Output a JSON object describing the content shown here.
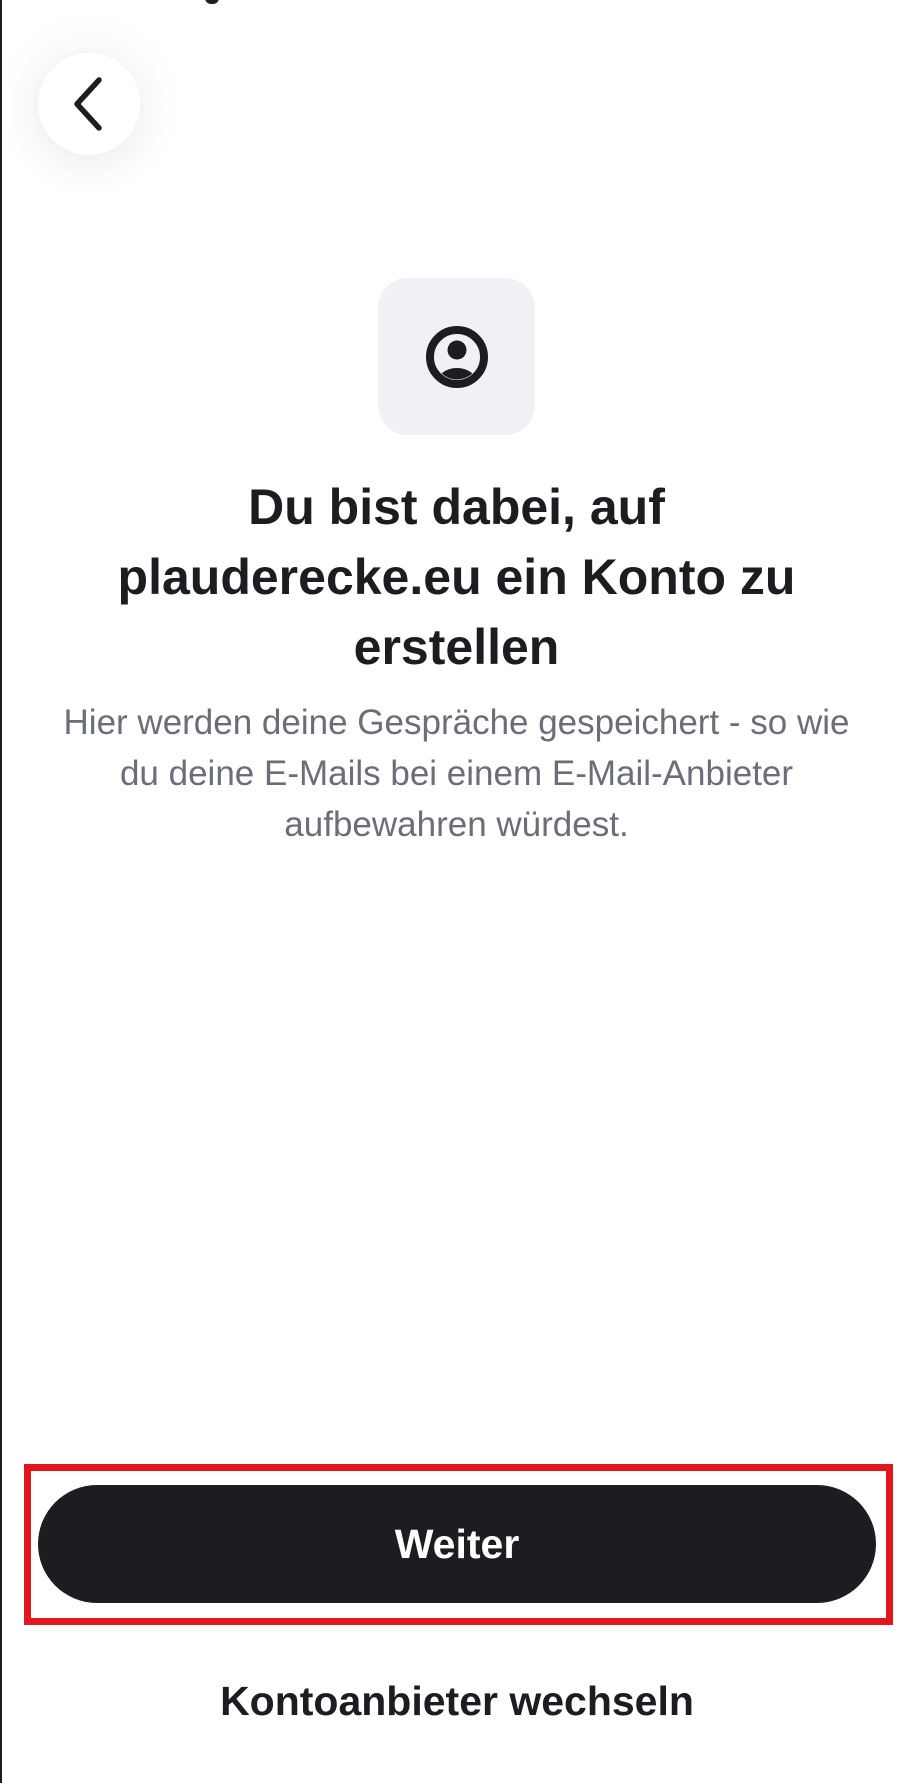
{
  "header": {
    "back_icon": "chevron-left-icon"
  },
  "hero": {
    "icon": "account-circle-icon",
    "tile_color": "#f0f1f5"
  },
  "content": {
    "headline": "Du bist dabei, auf plauderecke.eu ein Konto zu erstellen",
    "description": "Hier werden deine Gespräche gespeichert - so wie du deine E-Mails bei einem E-Mail-Anbieter aufbewahren würdest."
  },
  "actions": {
    "primary_label": "Weiter",
    "secondary_label": "Kontoanbieter wechseln"
  },
  "colors": {
    "primary_button_bg": "#1b1d21",
    "primary_button_text": "#ffffff",
    "highlight": "#e3161d",
    "description_text": "#6b6e78"
  }
}
